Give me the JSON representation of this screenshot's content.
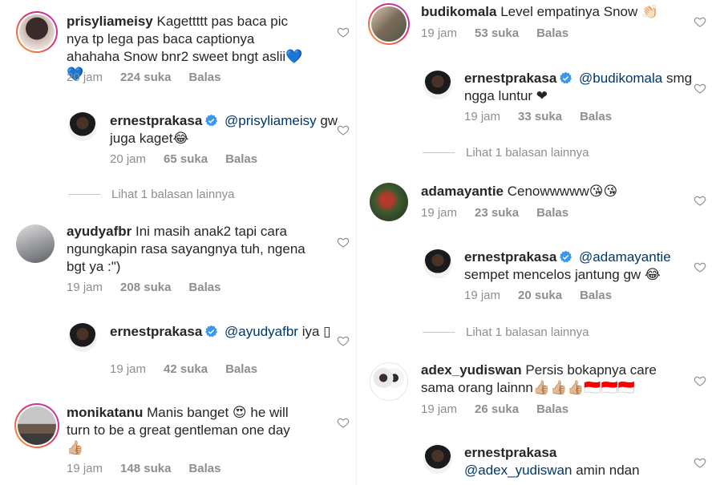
{
  "left": [
    {
      "user": "prisyliameisy",
      "text": "Kagettttt pas baca pic nya tp lega pas baca captionya ahahaha Snow bnr2 sweet bngt aslii💙💙",
      "time": "20 jam",
      "likes": "224 suka",
      "reply": "Balas"
    },
    {
      "user": "ernestprakasa",
      "mention": "@prisyliameisy",
      "text": "gw juga kaget😂",
      "time": "20 jam",
      "likes": "65 suka",
      "reply": "Balas"
    },
    {
      "more": "Lihat 1 balasan lainnya"
    },
    {
      "user": "ayudyafbr",
      "text": "Ini masih anak2 tapi cara ngungkapin rasa sayangnya tuh, ngena bgt ya :\")",
      "time": "19 jam",
      "likes": "208 suka",
      "reply": "Balas"
    },
    {
      "user": "ernestprakasa",
      "mention": "@ayudyafbr",
      "text": "iya ▯",
      "time": "19 jam",
      "likes": "42 suka",
      "reply": "Balas"
    },
    {
      "user": "monikatanu",
      "text": "Manis banget 😍 he will turn to be a great gentleman one day 👍🏼",
      "time": "19 jam",
      "likes": "148 suka",
      "reply": "Balas"
    }
  ],
  "right": [
    {
      "user": "budikomala",
      "text": "Level empatinya Snow 👏🏻",
      "time": "19 jam",
      "likes": "53 suka",
      "reply": "Balas"
    },
    {
      "user": "ernestprakasa",
      "mention": "@budikomala",
      "text": "smg ngga luntur ❤",
      "time": "19 jam",
      "likes": "33 suka",
      "reply": "Balas"
    },
    {
      "more": "Lihat 1 balasan lainnya"
    },
    {
      "user": "adamayantie",
      "text": "Cenowwwww😘😘",
      "time": "19 jam",
      "likes": "23 suka",
      "reply": "Balas"
    },
    {
      "user": "ernestprakasa",
      "mention": "@adamayantie",
      "text": "sempet mencelos jantung gw 😂",
      "time": "19 jam",
      "likes": "20 suka",
      "reply": "Balas"
    },
    {
      "more": "Lihat 1 balasan lainnya"
    },
    {
      "user": "adex_yudiswan",
      "text": "Persis bokapnya care sama orang lainnn👍🏼👍🏼👍🏼🇮🇩🇮🇩🇮🇩",
      "time": "19 jam",
      "likes": "26 suka",
      "reply": "Balas"
    },
    {
      "user": "ernestprakasa",
      "mention": "@adex_yudiswan",
      "text": "amin ndan",
      "time": "",
      "likes": "",
      "reply": ""
    }
  ],
  "icons": {
    "verified": "verified-badge-icon",
    "heart": "heart-outline-icon"
  },
  "colors": {
    "verified": "#3897f0",
    "mention": "#00376b",
    "meta": "#8e8e8e"
  }
}
